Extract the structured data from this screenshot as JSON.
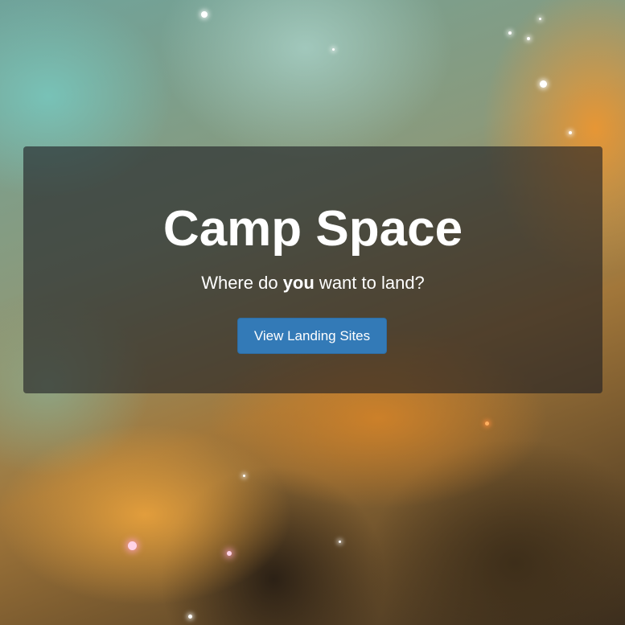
{
  "hero": {
    "title": "Camp Space",
    "subtitle_before": "Where do ",
    "subtitle_emphasis": "you",
    "subtitle_after": " want to land?",
    "button_label": "View Landing Sites"
  },
  "colors": {
    "button_bg": "#337ab7",
    "card_overlay": "rgba(30,30,35,0.62)",
    "text": "#ffffff"
  }
}
